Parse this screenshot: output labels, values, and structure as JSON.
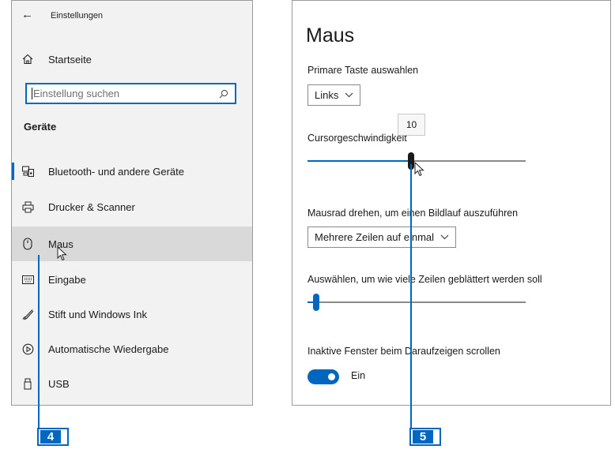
{
  "settings_nav": {
    "back_icon": "back-arrow-icon",
    "window_title": "Einstellungen",
    "home_label": "Startseite",
    "search_placeholder": "Einstellung suchen",
    "section_title": "Geräte",
    "items": [
      {
        "label": "Bluetooth- und andere Geräte",
        "icon": "bluetooth-devices-icon",
        "selected": false
      },
      {
        "label": "Drucker & Scanner",
        "icon": "printer-icon",
        "selected": false
      },
      {
        "label": "Maus",
        "icon": "mouse-icon",
        "selected": true
      },
      {
        "label": "Eingabe",
        "icon": "keyboard-icon",
        "selected": false
      },
      {
        "label": "Stift und Windows Ink",
        "icon": "pen-icon",
        "selected": false
      },
      {
        "label": "Automatische Wiedergabe",
        "icon": "autoplay-icon",
        "selected": false
      },
      {
        "label": "USB",
        "icon": "usb-icon",
        "selected": false
      }
    ]
  },
  "mouse_page": {
    "title": "Maus",
    "primary_button": {
      "label": "Primare Taste auswahlen",
      "value": "Links"
    },
    "cursor_speed": {
      "label": "Cursorgeschwindigkeit",
      "tooltip": "10",
      "value": 10,
      "min": 1,
      "max": 20
    },
    "wheel": {
      "label": "Mausrad drehen, um einen Bildlauf auszuführen",
      "value": "Mehrere Zeilen auf einmal"
    },
    "lines": {
      "label": "Auswählen, um wie viele Zeilen geblättert werden soll",
      "value_fraction": 0.04
    },
    "inactive_scroll": {
      "label": "Inaktive Fenster beim Daraufzeigen scrollen",
      "state": "Ein",
      "on": true
    }
  },
  "callouts": [
    {
      "number": "4"
    },
    {
      "number": "5"
    }
  ],
  "colors": {
    "accent": "#0067c0",
    "nav_background": "#f2f2f2",
    "selected_row": "#d9d9d9"
  }
}
